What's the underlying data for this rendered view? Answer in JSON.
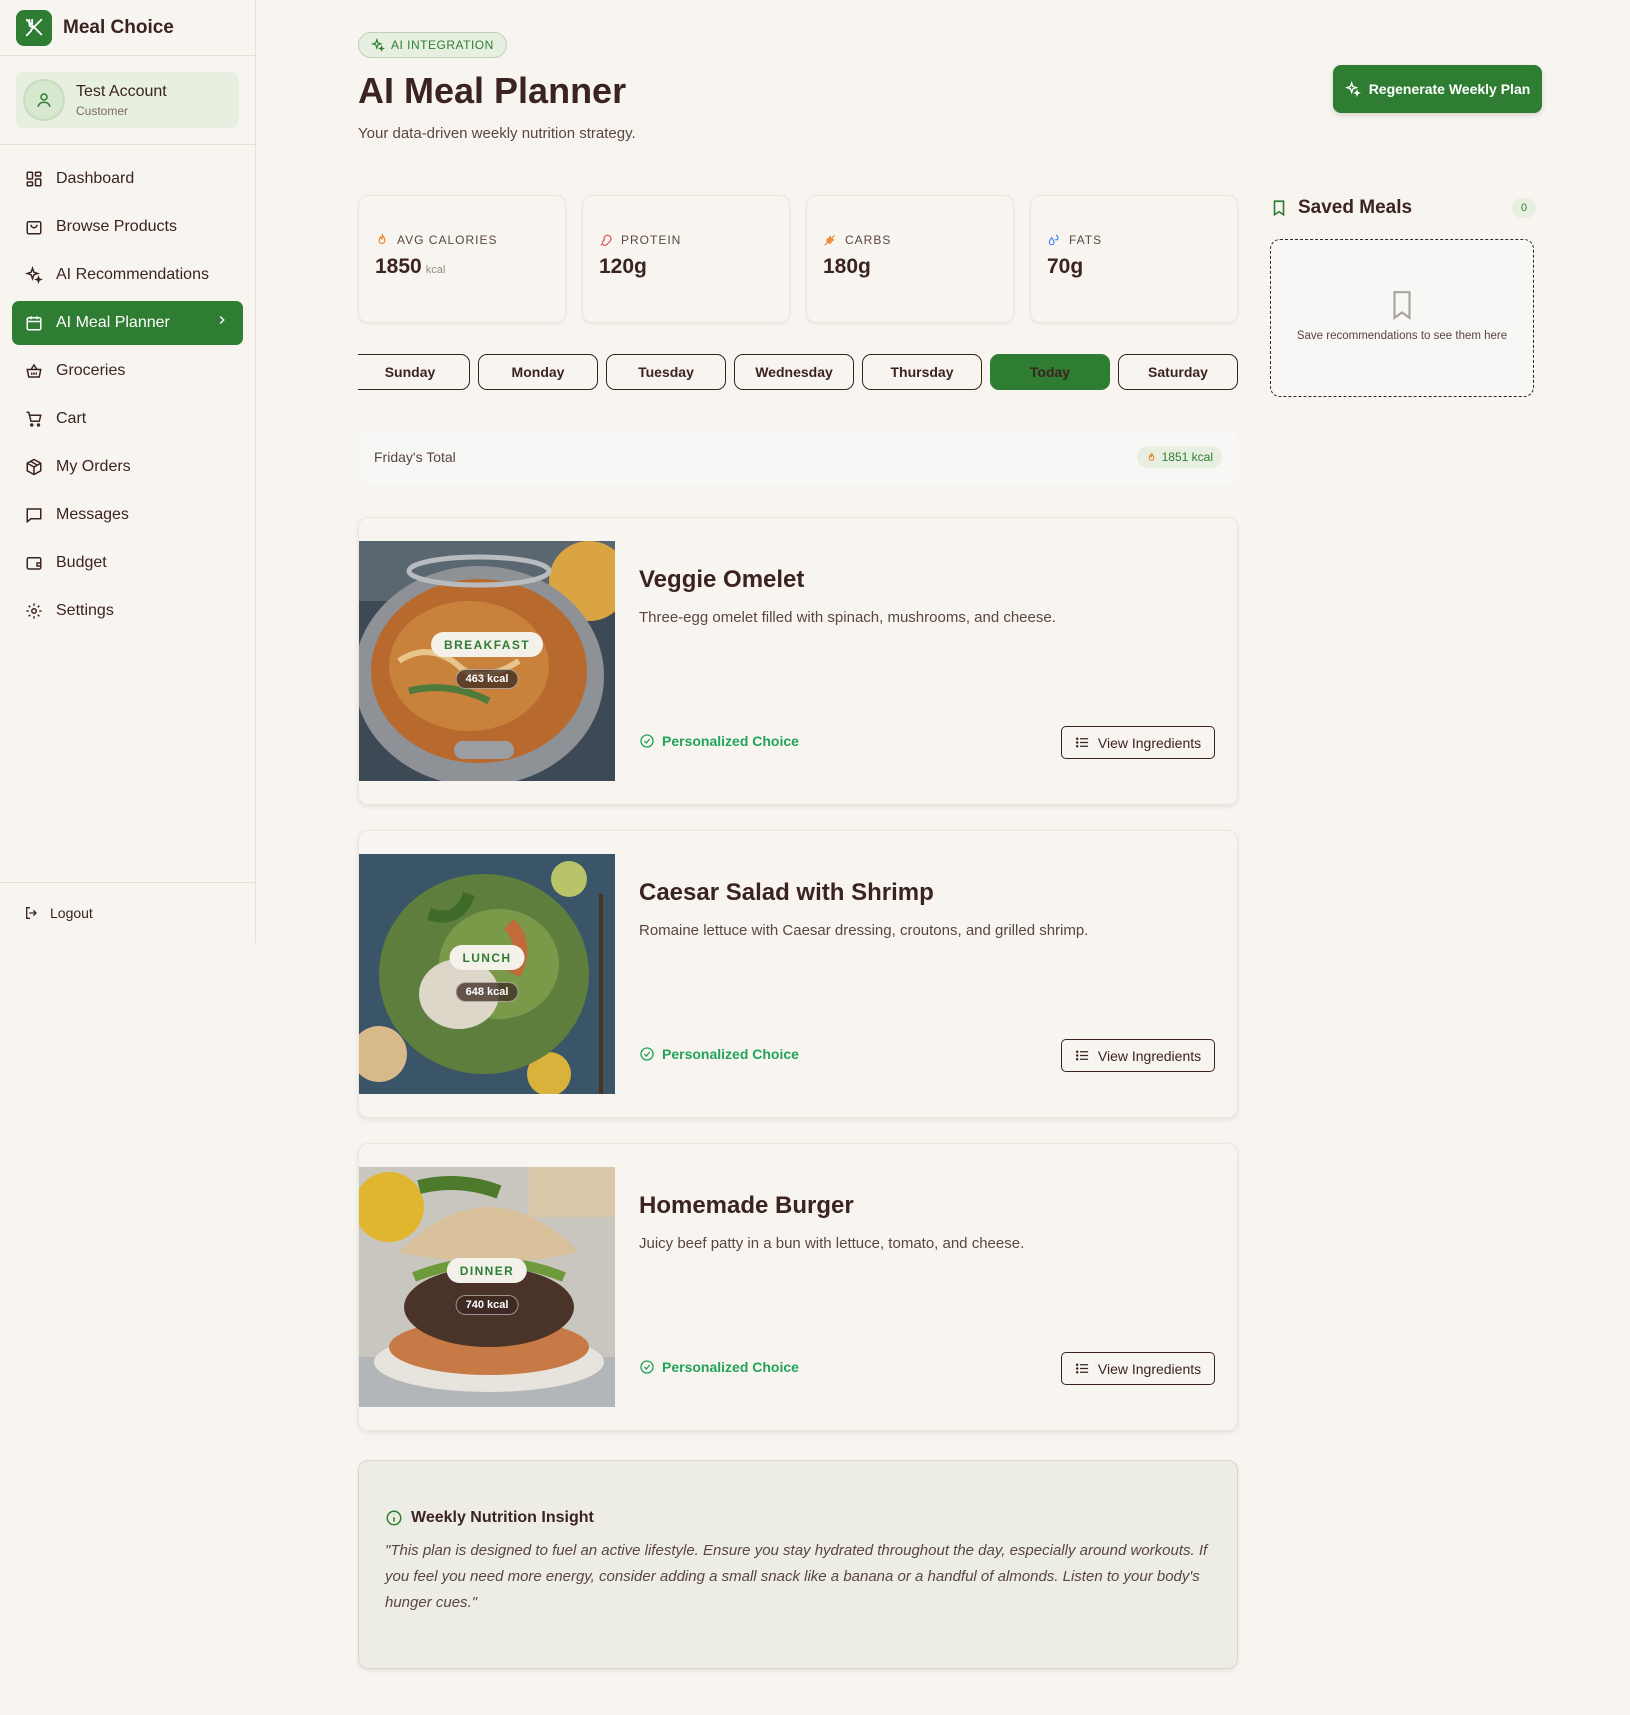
{
  "app": {
    "name": "Meal Choice"
  },
  "account": {
    "name": "Test Account",
    "role": "Customer"
  },
  "nav": [
    {
      "label": "Dashboard",
      "icon": "dashboard-icon"
    },
    {
      "label": "Browse Products",
      "icon": "shopping-bag-icon"
    },
    {
      "label": "AI Recommendations",
      "icon": "sparkles-icon"
    },
    {
      "label": "AI Meal Planner",
      "icon": "calendar-icon",
      "active": true
    },
    {
      "label": "Groceries",
      "icon": "basket-icon"
    },
    {
      "label": "Cart",
      "icon": "cart-icon"
    },
    {
      "label": "My Orders",
      "icon": "package-icon"
    },
    {
      "label": "Messages",
      "icon": "message-icon"
    },
    {
      "label": "Budget",
      "icon": "wallet-icon"
    },
    {
      "label": "Settings",
      "icon": "settings-icon"
    }
  ],
  "logout_label": "Logout",
  "header": {
    "pill": "AI INTEGRATION",
    "title": "AI Meal Planner",
    "subtitle": "Your data-driven weekly nutrition strategy.",
    "regenerate_label": "Regenerate Weekly Plan"
  },
  "stats": [
    {
      "label": "AVG CALORIES",
      "value": "1850",
      "unit": "kcal",
      "icon": "flame-icon",
      "color": "#e8862a"
    },
    {
      "label": "PROTEIN",
      "value": "120g",
      "unit": "",
      "icon": "meat-icon",
      "color": "#d9534f"
    },
    {
      "label": "CARBS",
      "value": "180g",
      "unit": "",
      "icon": "wheat-icon",
      "color": "#e8862a"
    },
    {
      "label": "FATS",
      "value": "70g",
      "unit": "",
      "icon": "droplets-icon",
      "color": "#3b82f6"
    }
  ],
  "days": [
    "Sunday",
    "Monday",
    "Tuesday",
    "Wednesday",
    "Thursday",
    "Today",
    "Saturday"
  ],
  "active_day_index": 5,
  "day_total": {
    "label": "Friday's Total",
    "kcal": "1851 kcal"
  },
  "meals": [
    {
      "tag": "BREAKFAST",
      "kcal": "463 kcal",
      "name": "Veggie Omelet",
      "description": "Three-egg omelet filled with spinach, mushrooms, and cheese.",
      "personal": "Personalized Choice",
      "button": "View Ingredients"
    },
    {
      "tag": "LUNCH",
      "kcal": "648 kcal",
      "name": "Caesar Salad with Shrimp",
      "description": "Romaine lettuce with Caesar dressing, croutons, and grilled shrimp.",
      "personal": "Personalized Choice",
      "button": "View Ingredients"
    },
    {
      "tag": "DINNER",
      "kcal": "740 kcal",
      "name": "Homemade Burger",
      "description": "Juicy beef patty in a bun with lettuce, tomato, and cheese.",
      "personal": "Personalized Choice",
      "button": "View Ingredients"
    }
  ],
  "insight": {
    "title": "Weekly Nutrition Insight",
    "text": "\"This plan is designed to fuel an active lifestyle. Ensure you stay hydrated throughout the day, especially around workouts. If you feel you need more energy, consider adding a small snack like a banana or a handful of almonds. Listen to your body's hunger cues.\""
  },
  "saved": {
    "title": "Saved Meals",
    "count": "0",
    "empty_text": "Save recommendations to see them here"
  },
  "colors": {
    "primary": "#2e7d32",
    "text": "#3b2320",
    "background": "#f8f5f0",
    "success": "#22a35a"
  }
}
